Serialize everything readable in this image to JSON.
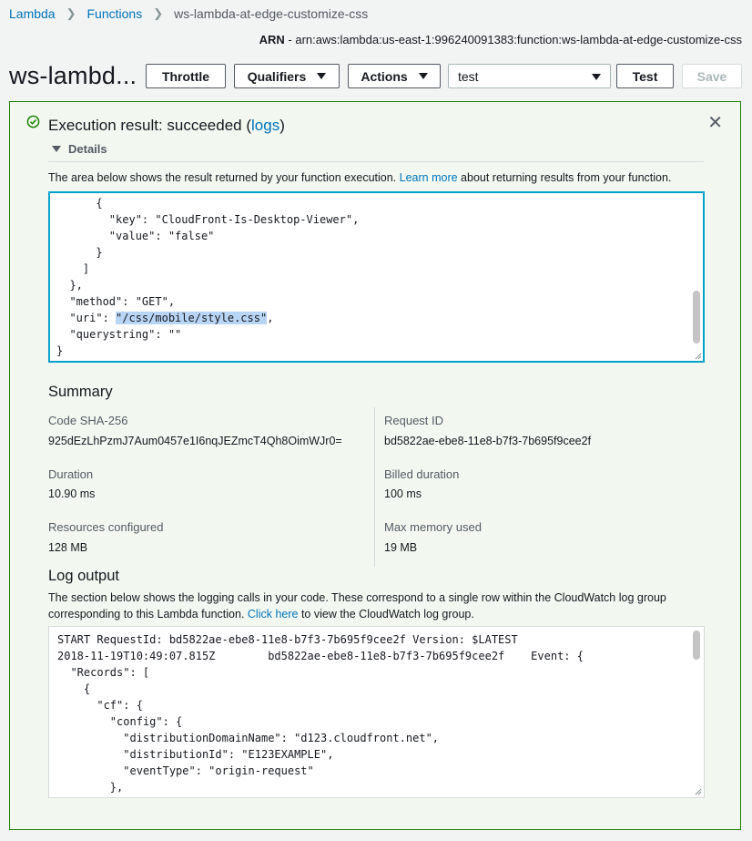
{
  "breadcrumb": {
    "items": [
      "Lambda",
      "Functions"
    ],
    "current": "ws-lambda-at-edge-customize-css"
  },
  "arn": {
    "label": "ARN",
    "value": " - arn:aws:lambda:us-east-1:996240091383:function:ws-lambda-at-edge-customize-css"
  },
  "function_title": "ws-lambd...",
  "toolbar": {
    "throttle": "Throttle",
    "qualifiers": "Qualifiers",
    "actions": "Actions",
    "test_event": "test",
    "test": "Test",
    "save": "Save"
  },
  "result": {
    "status_prefix": "Execution result: succeeded (",
    "logs_link": "logs",
    "status_suffix": ")",
    "details_label": "Details",
    "description_prefix": "The area below shows the result returned by your function execution. ",
    "learn_more": "Learn more",
    "description_suffix": " about returning results from your function.",
    "code_lines": [
      "      {",
      "        \"key\": \"CloudFront-Is-Desktop-Viewer\",",
      "        \"value\": \"false\"",
      "      }",
      "    ]",
      "  },",
      "  \"method\": \"GET\","
    ],
    "uri_prefix": "  \"uri\": ",
    "uri_value": "\"/css/mobile/style.css\"",
    "uri_suffix": ",",
    "code_lines_after": [
      "  \"querystring\": \"\"",
      "}"
    ]
  },
  "summary": {
    "heading": "Summary",
    "code_sha_label": "Code SHA-256",
    "code_sha_value": "925dEzLhPzmJ7Aum0457e1I6nqJEZmcT4Qh8OimWJr0=",
    "request_id_label": "Request ID",
    "request_id_value": "bd5822ae-ebe8-11e8-b7f3-7b695f9cee2f",
    "duration_label": "Duration",
    "duration_value": "10.90 ms",
    "billed_label": "Billed duration",
    "billed_value": "100 ms",
    "resources_label": "Resources configured",
    "resources_value": "128 MB",
    "maxmem_label": "Max memory used",
    "maxmem_value": "19 MB"
  },
  "log": {
    "heading": "Log output",
    "description_prefix": "The section below shows the logging calls in your code. These correspond to a single row within the CloudWatch log group corresponding to this Lambda function. ",
    "click_here": "Click here",
    "description_suffix": " to view the CloudWatch log group.",
    "lines": [
      "START RequestId: bd5822ae-ebe8-11e8-b7f3-7b695f9cee2f Version: $LATEST",
      "2018-11-19T10:49:07.815Z        bd5822ae-ebe8-11e8-b7f3-7b695f9cee2f    Event: {",
      "  \"Records\": [",
      "    {",
      "      \"cf\": {",
      "        \"config\": {",
      "          \"distributionDomainName\": \"d123.cloudfront.net\",",
      "          \"distributionId\": \"E123EXAMPLE\",",
      "          \"eventType\": \"origin-request\"",
      "        },"
    ]
  },
  "colors": {
    "link": "#0073bb",
    "success": "#1d8102",
    "panel_bg": "#f2f8f0"
  }
}
